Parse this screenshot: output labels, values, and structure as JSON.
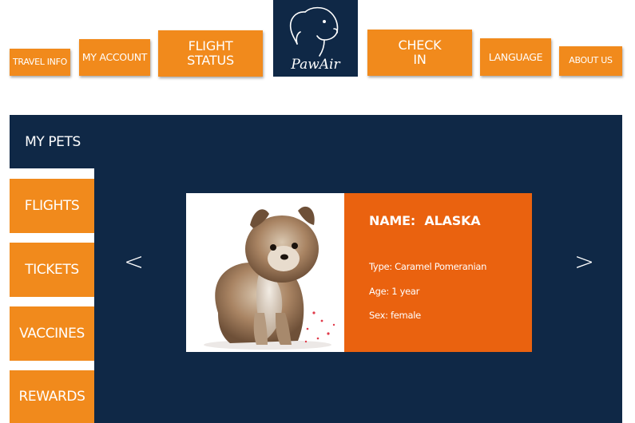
{
  "brand": {
    "name": "PawAir",
    "colors": {
      "navy": "#0f2846",
      "orange": "#f18a1c",
      "card_orange": "#ea620f"
    }
  },
  "nav": {
    "travel_info": "TRAVEL INFO",
    "my_account": "MY ACCOUNT",
    "flight_status_line1": "FLIGHT",
    "flight_status_line2": "STATUS",
    "check_in_line1": "CHECK",
    "check_in_line2": "IN",
    "language": "LANGUAGE",
    "about_us": "ABOUT US"
  },
  "sidebar": {
    "active": "MY PETS",
    "items": [
      "FLIGHTS",
      "TICKETS",
      "VACCINES",
      "REWARDS"
    ]
  },
  "carousel": {
    "prev_glyph": "<",
    "next_glyph": ">"
  },
  "pet": {
    "name_label": "NAME:",
    "name": "ALASKA",
    "type_label": "Type:",
    "type": "Caramel Pomeranian",
    "age_label": "Age:",
    "age": "1 year",
    "sex_label": "Sex:",
    "sex": "female",
    "photo_icon": "pomeranian-puppy-photo"
  }
}
